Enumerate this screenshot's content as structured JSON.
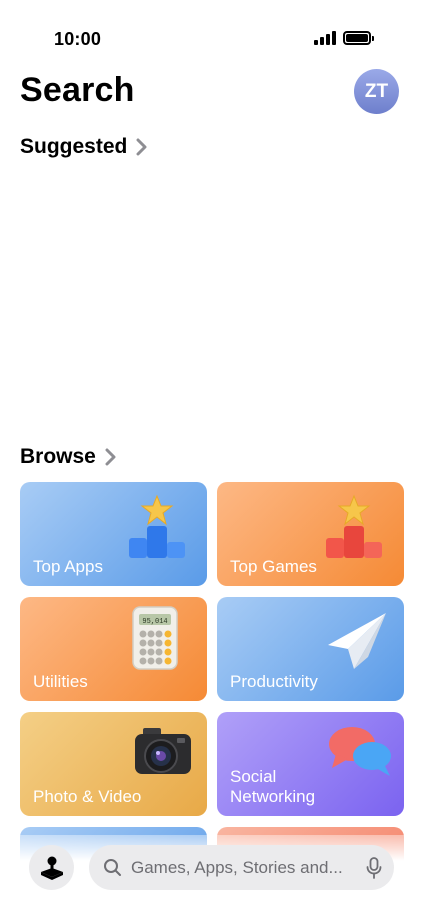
{
  "status_bar": {
    "time": "10:00"
  },
  "header": {
    "title": "Search",
    "avatar_initials": "ZT"
  },
  "suggested": {
    "label": "Suggested"
  },
  "browse": {
    "label": "Browse",
    "tiles": [
      {
        "label": "Top Apps",
        "icon": "podium-star-blue-icon"
      },
      {
        "label": "Top Games",
        "icon": "podium-star-red-icon"
      },
      {
        "label": "Utilities",
        "icon": "calculator-icon",
        "icon_text": "95,014"
      },
      {
        "label": "Productivity",
        "icon": "paper-plane-icon"
      },
      {
        "label": "Photo & Video",
        "icon": "camera-icon"
      },
      {
        "label": "Social\nNetworking",
        "icon": "chat-bubbles-icon"
      }
    ]
  },
  "bottom_bar": {
    "search_placeholder": "Games, Apps, Stories and...",
    "arcade_icon": "joystick-icon",
    "search_icon": "search-icon",
    "mic_icon": "microphone-icon"
  },
  "colors": {
    "avatar": "#8393db",
    "tile_blue": "#6fa7ec",
    "tile_orange": "#f89b52",
    "tile_gold": "#edb85a",
    "tile_purple": "#8f78f3",
    "tile_pink": "#f6907a"
  }
}
